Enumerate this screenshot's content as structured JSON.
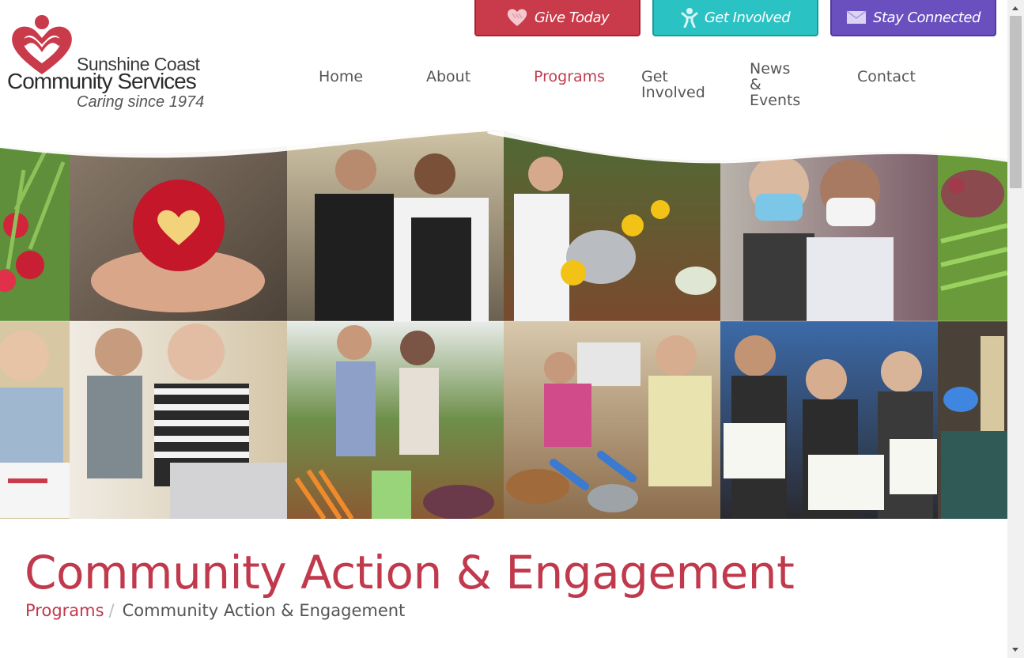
{
  "brand": {
    "name_line1": "Sunshine Coast",
    "name_line2": "Community Services",
    "tagline": "Caring since 1974",
    "colors": {
      "red": "#c0394c",
      "teal": "#2bc2c3",
      "purple": "#6a50bf"
    }
  },
  "cta_buttons": {
    "give": {
      "label": "Give Today",
      "icon": "heart-icon"
    },
    "involved": {
      "label": "Get Involved",
      "icon": "person-icon"
    },
    "connected": {
      "label": "Stay Connected",
      "icon": "envelope-icon"
    }
  },
  "nav": {
    "home": "Home",
    "about": "About",
    "programs": "Programs",
    "get_involved": "Get Involved",
    "news_line1": "News &",
    "news_line2": "Events",
    "contact": "Contact",
    "active": "Programs"
  },
  "hero": {
    "tiles_top": [
      "radishes-photo",
      "apple-heart-photo",
      "kitchen-volunteers-photo",
      "garden-harvest-photo",
      "masked-friends-photo",
      "beets-photo"
    ],
    "tiles_bottom": [
      "girl-card-photo",
      "senior-laptop-photo",
      "farmers-market-photo",
      "masked-cooks-photo",
      "certificates-photo",
      "gloved-hands-photo"
    ]
  },
  "page": {
    "title": "Community Action & Engagement",
    "breadcrumb": {
      "parent": "Programs",
      "separator": "/",
      "current": "Community Action & Engagement"
    }
  }
}
